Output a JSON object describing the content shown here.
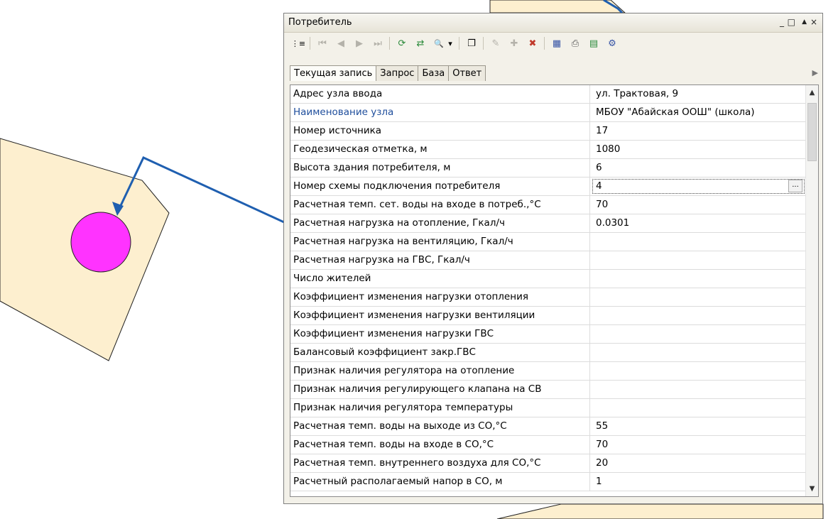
{
  "panel": {
    "title": "Потребитель",
    "window_controls": [
      "_",
      "□",
      "▲",
      "×"
    ]
  },
  "toolbar": {
    "buttons": [
      {
        "icon": "fields-icon",
        "glyph": "⋮≡"
      },
      {
        "icon": "first-record-icon",
        "glyph": "⏮"
      },
      {
        "icon": "prev-record-icon",
        "glyph": "◀"
      },
      {
        "icon": "next-record-icon",
        "glyph": "▶"
      },
      {
        "icon": "last-record-icon",
        "glyph": "⏭"
      },
      {
        "icon": "refresh-icon",
        "glyph": "⟳"
      },
      {
        "icon": "sync-icon",
        "glyph": "⇄"
      },
      {
        "icon": "find-icon",
        "glyph": "🔍"
      },
      {
        "icon": "dropdown-icon",
        "glyph": "▾"
      },
      {
        "icon": "new-window-icon",
        "glyph": "❐"
      },
      {
        "icon": "edit-record-icon",
        "glyph": "✎"
      },
      {
        "icon": "add-record-icon",
        "glyph": "✚"
      },
      {
        "icon": "delete-record-icon",
        "glyph": "✖"
      },
      {
        "icon": "database-icon",
        "glyph": "▦"
      },
      {
        "icon": "print-icon",
        "glyph": "⎙"
      },
      {
        "icon": "export-icon",
        "glyph": "▤"
      },
      {
        "icon": "settings-icon",
        "glyph": "⚙"
      }
    ]
  },
  "tabs": [
    "Текущая запись",
    "Запрос",
    "База",
    "Ответ"
  ],
  "active_tab": "Текущая запись",
  "records": [
    {
      "name": "Адрес узла ввода",
      "value": "ул. Трактовая, 9"
    },
    {
      "name": "Наименование узла",
      "value": "МБОУ \"Абайская ООШ\" (школа)"
    },
    {
      "name": "Номер источника",
      "value": "17"
    },
    {
      "name": "Геодезическая отметка, м",
      "value": "1080"
    },
    {
      "name": "Высота здания потребителя, м",
      "value": "6"
    },
    {
      "name": "Номер схемы подключения потребителя",
      "value": "4"
    },
    {
      "name": "Расчетная темп. сет. воды на входе в потреб.,°С",
      "value": "70"
    },
    {
      "name": "Расчетная нагрузка на отопление, Гкал/ч",
      "value": "0.0301"
    },
    {
      "name": "Расчетная нагрузка на вентиляцию, Гкал/ч",
      "value": ""
    },
    {
      "name": "Расчетная нагрузка на ГВС, Гкал/ч",
      "value": ""
    },
    {
      "name": "Число жителей",
      "value": ""
    },
    {
      "name": "Коэффициент изменения нагрузки отопления",
      "value": ""
    },
    {
      "name": "Коэффициент изменения нагрузки вентиляции",
      "value": ""
    },
    {
      "name": "Коэффициент изменения нагрузки ГВС",
      "value": ""
    },
    {
      "name": "Балансовый коэффициент закр.ГВС",
      "value": ""
    },
    {
      "name": "Признак наличия регулятора на отопление",
      "value": ""
    },
    {
      "name": "Признак наличия регулирующего клапана на СВ",
      "value": ""
    },
    {
      "name": "Признак наличия регулятора температуры",
      "value": ""
    },
    {
      "name": "Расчетная темп. воды на выходе из СО,°С",
      "value": "55"
    },
    {
      "name": "Расчетная темп. воды на входе в СО,°С",
      "value": "70"
    },
    {
      "name": "Расчетная темп. внутреннего воздуха для СО,°С",
      "value": "20"
    },
    {
      "name": "Расчетный располагаемый напор в СО, м",
      "value": "1"
    }
  ],
  "link_row_index": 1,
  "editing_row_index": 5,
  "editor_button": "...",
  "scrollbar": {
    "up": "▲",
    "down": "▼"
  },
  "colors": {
    "building_fill": "#fdefcf",
    "consumer_node": "#ff33ff",
    "pipe": "#1f5fb0"
  }
}
